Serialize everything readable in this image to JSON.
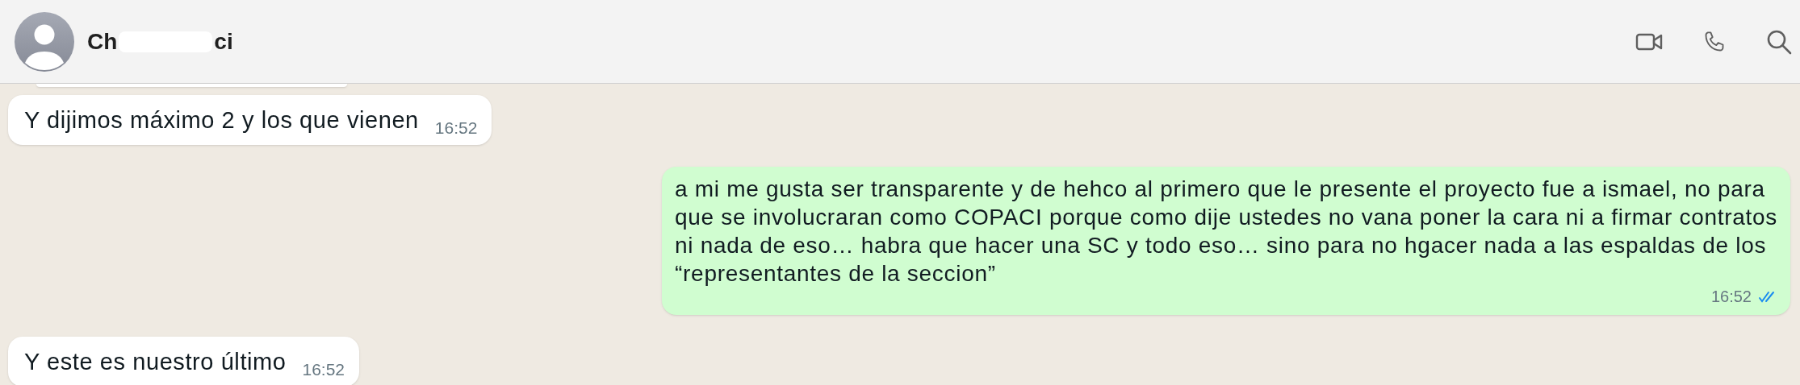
{
  "header": {
    "title_parts": [
      "Ch",
      "ci"
    ],
    "redacted": true
  },
  "messages": [
    {
      "kind": "cut"
    },
    {
      "kind": "incoming",
      "lines": [
        "Y dijimos máximo 2 y los que vienen"
      ],
      "time": "16:52"
    },
    {
      "kind": "outgoing",
      "lines": [
        "a mi me gusta ser transparente y de hehco al primero que le presente el proyecto fue a ismael, no para",
        "que se involucraran como COPACI porque como dije ustedes no vana poner la cara ni a firmar contratos",
        "ni nada de eso… habra que hacer una SC y todo eso… sino para no hgacer nada a las espaldas de los",
        "“representantes de la seccion”"
      ],
      "time": "16:52",
      "read": true
    },
    {
      "kind": "incoming",
      "lines": [
        "Y este es nuestro último"
      ],
      "time": "16:52"
    }
  ]
}
